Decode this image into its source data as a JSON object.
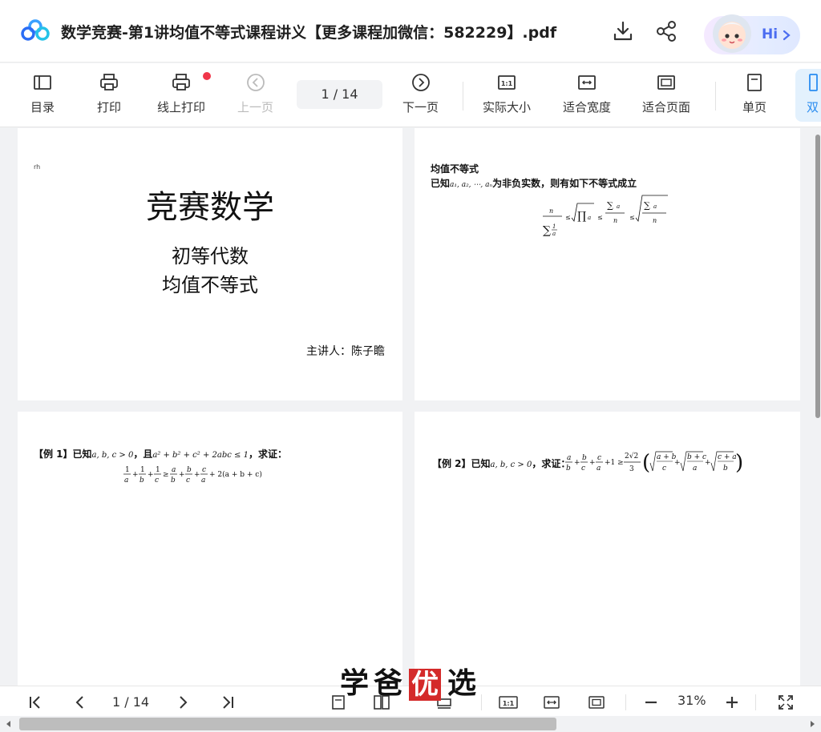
{
  "title_bar": {
    "document_title": "数学竞赛-第1讲均值不等式课程讲义【更多课程加微信：582229】.pdf",
    "hi_label": "Hi",
    "icons": [
      "cloud-logo-icon",
      "download-icon",
      "share-icon",
      "assistant-avatar-icon",
      "chevron-right-icon"
    ]
  },
  "toolbar": {
    "items": [
      {
        "label": "目录",
        "icon": "toc-icon"
      },
      {
        "label": "打印",
        "icon": "printer-icon"
      },
      {
        "label": "线上打印",
        "icon": "online-print-icon"
      },
      {
        "label": "上一页",
        "icon": "prev-page-icon"
      },
      {
        "label": "下一页",
        "icon": "next-page-icon"
      },
      {
        "label": "实际大小",
        "icon": "actual-size-icon"
      },
      {
        "label": "适合宽度",
        "icon": "fit-width-icon"
      },
      {
        "label": "适合页面",
        "icon": "fit-page-icon"
      },
      {
        "label": "单页",
        "icon": "single-page-icon"
      },
      {
        "label": "双",
        "icon": "double-page-icon"
      }
    ],
    "page_indicator": "1  / 14"
  },
  "pages": {
    "page1": {
      "corner_mark": "rh",
      "title": "竞赛数学",
      "subtitle_1": "初等代数",
      "subtitle_2": "均值不等式",
      "speaker": "主讲人：陈子瞻"
    },
    "page2": {
      "heading": "均值不等式",
      "statement_prefix": "已知",
      "statement_vars": "a₁, a₂, ⋯, aₙ",
      "statement_suffix": "为非负实数，则有如下不等式成立"
    },
    "page3": {
      "label": "【例 1】已知",
      "cond_1": "a, b, c > 0",
      "mid": "，且",
      "cond_2": "a² + b² + c² + 2abc ≤ 1",
      "tail": "，求证：",
      "inequality_rhs": "+ 2(a + b + c)"
    },
    "page4": {
      "label": "【例 2】已知",
      "cond": "a, b, c > 0",
      "tail": "，求证：",
      "coef": "2√2",
      "coef_den": "3",
      "plus_one": "+1 ≥",
      "radicals": [
        "a + b",
        "c",
        "b + c",
        "a",
        "c + a",
        "b"
      ]
    }
  },
  "watermark": {
    "t1": "学",
    "t2": "爸",
    "t3": "优",
    "t4": "选"
  },
  "bottom_bar": {
    "page_indicator": "1  / 14",
    "zoom": "31%",
    "icons": [
      "first-page-icon",
      "prev-icon",
      "next-icon",
      "last-page-icon",
      "single-view-icon",
      "double-view-icon",
      "continuous-view-icon",
      "actual-size-icon",
      "fit-width-icon",
      "fit-page-icon",
      "zoom-out-icon",
      "zoom-in-icon",
      "fullscreen-icon"
    ]
  }
}
